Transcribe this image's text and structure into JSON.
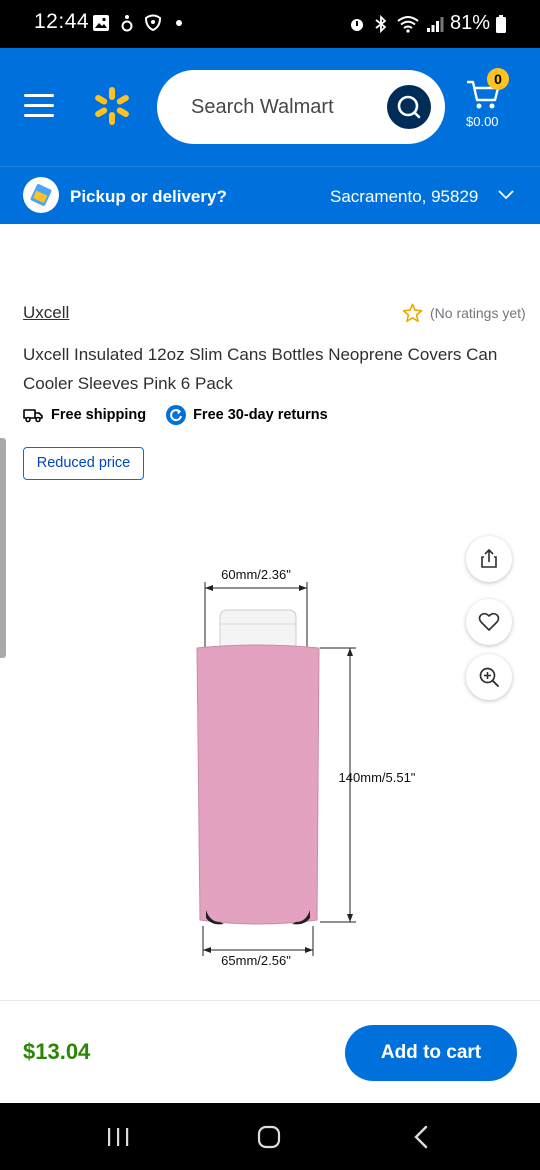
{
  "status_bar": {
    "time": "12:44",
    "battery": "81%",
    "icons": [
      "image-icon",
      "accessibility-icon",
      "shield-icon",
      "dot-icon",
      "alarm-icon",
      "bluetooth-icon",
      "wifi-icon",
      "signal-icon",
      "battery-icon"
    ]
  },
  "header": {
    "search_placeholder": "Search Walmart",
    "cart_count": "0",
    "cart_total": "$0.00",
    "brand_color": "#0071dc",
    "spark_color": "#ffc220"
  },
  "pickup": {
    "label": "Pickup or delivery?",
    "location": "Sacramento, 95829"
  },
  "product": {
    "brand": "Uxcell",
    "rating_text": "(No ratings yet)",
    "title": "Uxcell Insulated 12oz Slim Cans Bottles Neoprene Covers Can Cooler Sleeves Pink 6 Pack",
    "free_shipping": "Free shipping",
    "free_returns": "Free 30-day returns",
    "badge": "Reduced price",
    "image": {
      "dim_top": "60mm/2.36\"",
      "dim_height": "140mm/5.51\"",
      "dim_bottom": "65mm/2.56\"",
      "sleeve_color": "#e3a3c0"
    }
  },
  "buy_bar": {
    "price": "$13.04",
    "add_to_cart": "Add to cart",
    "price_color": "#2a8703"
  },
  "nav": {
    "icons": [
      "recent-apps-icon",
      "home-icon",
      "back-icon"
    ]
  }
}
